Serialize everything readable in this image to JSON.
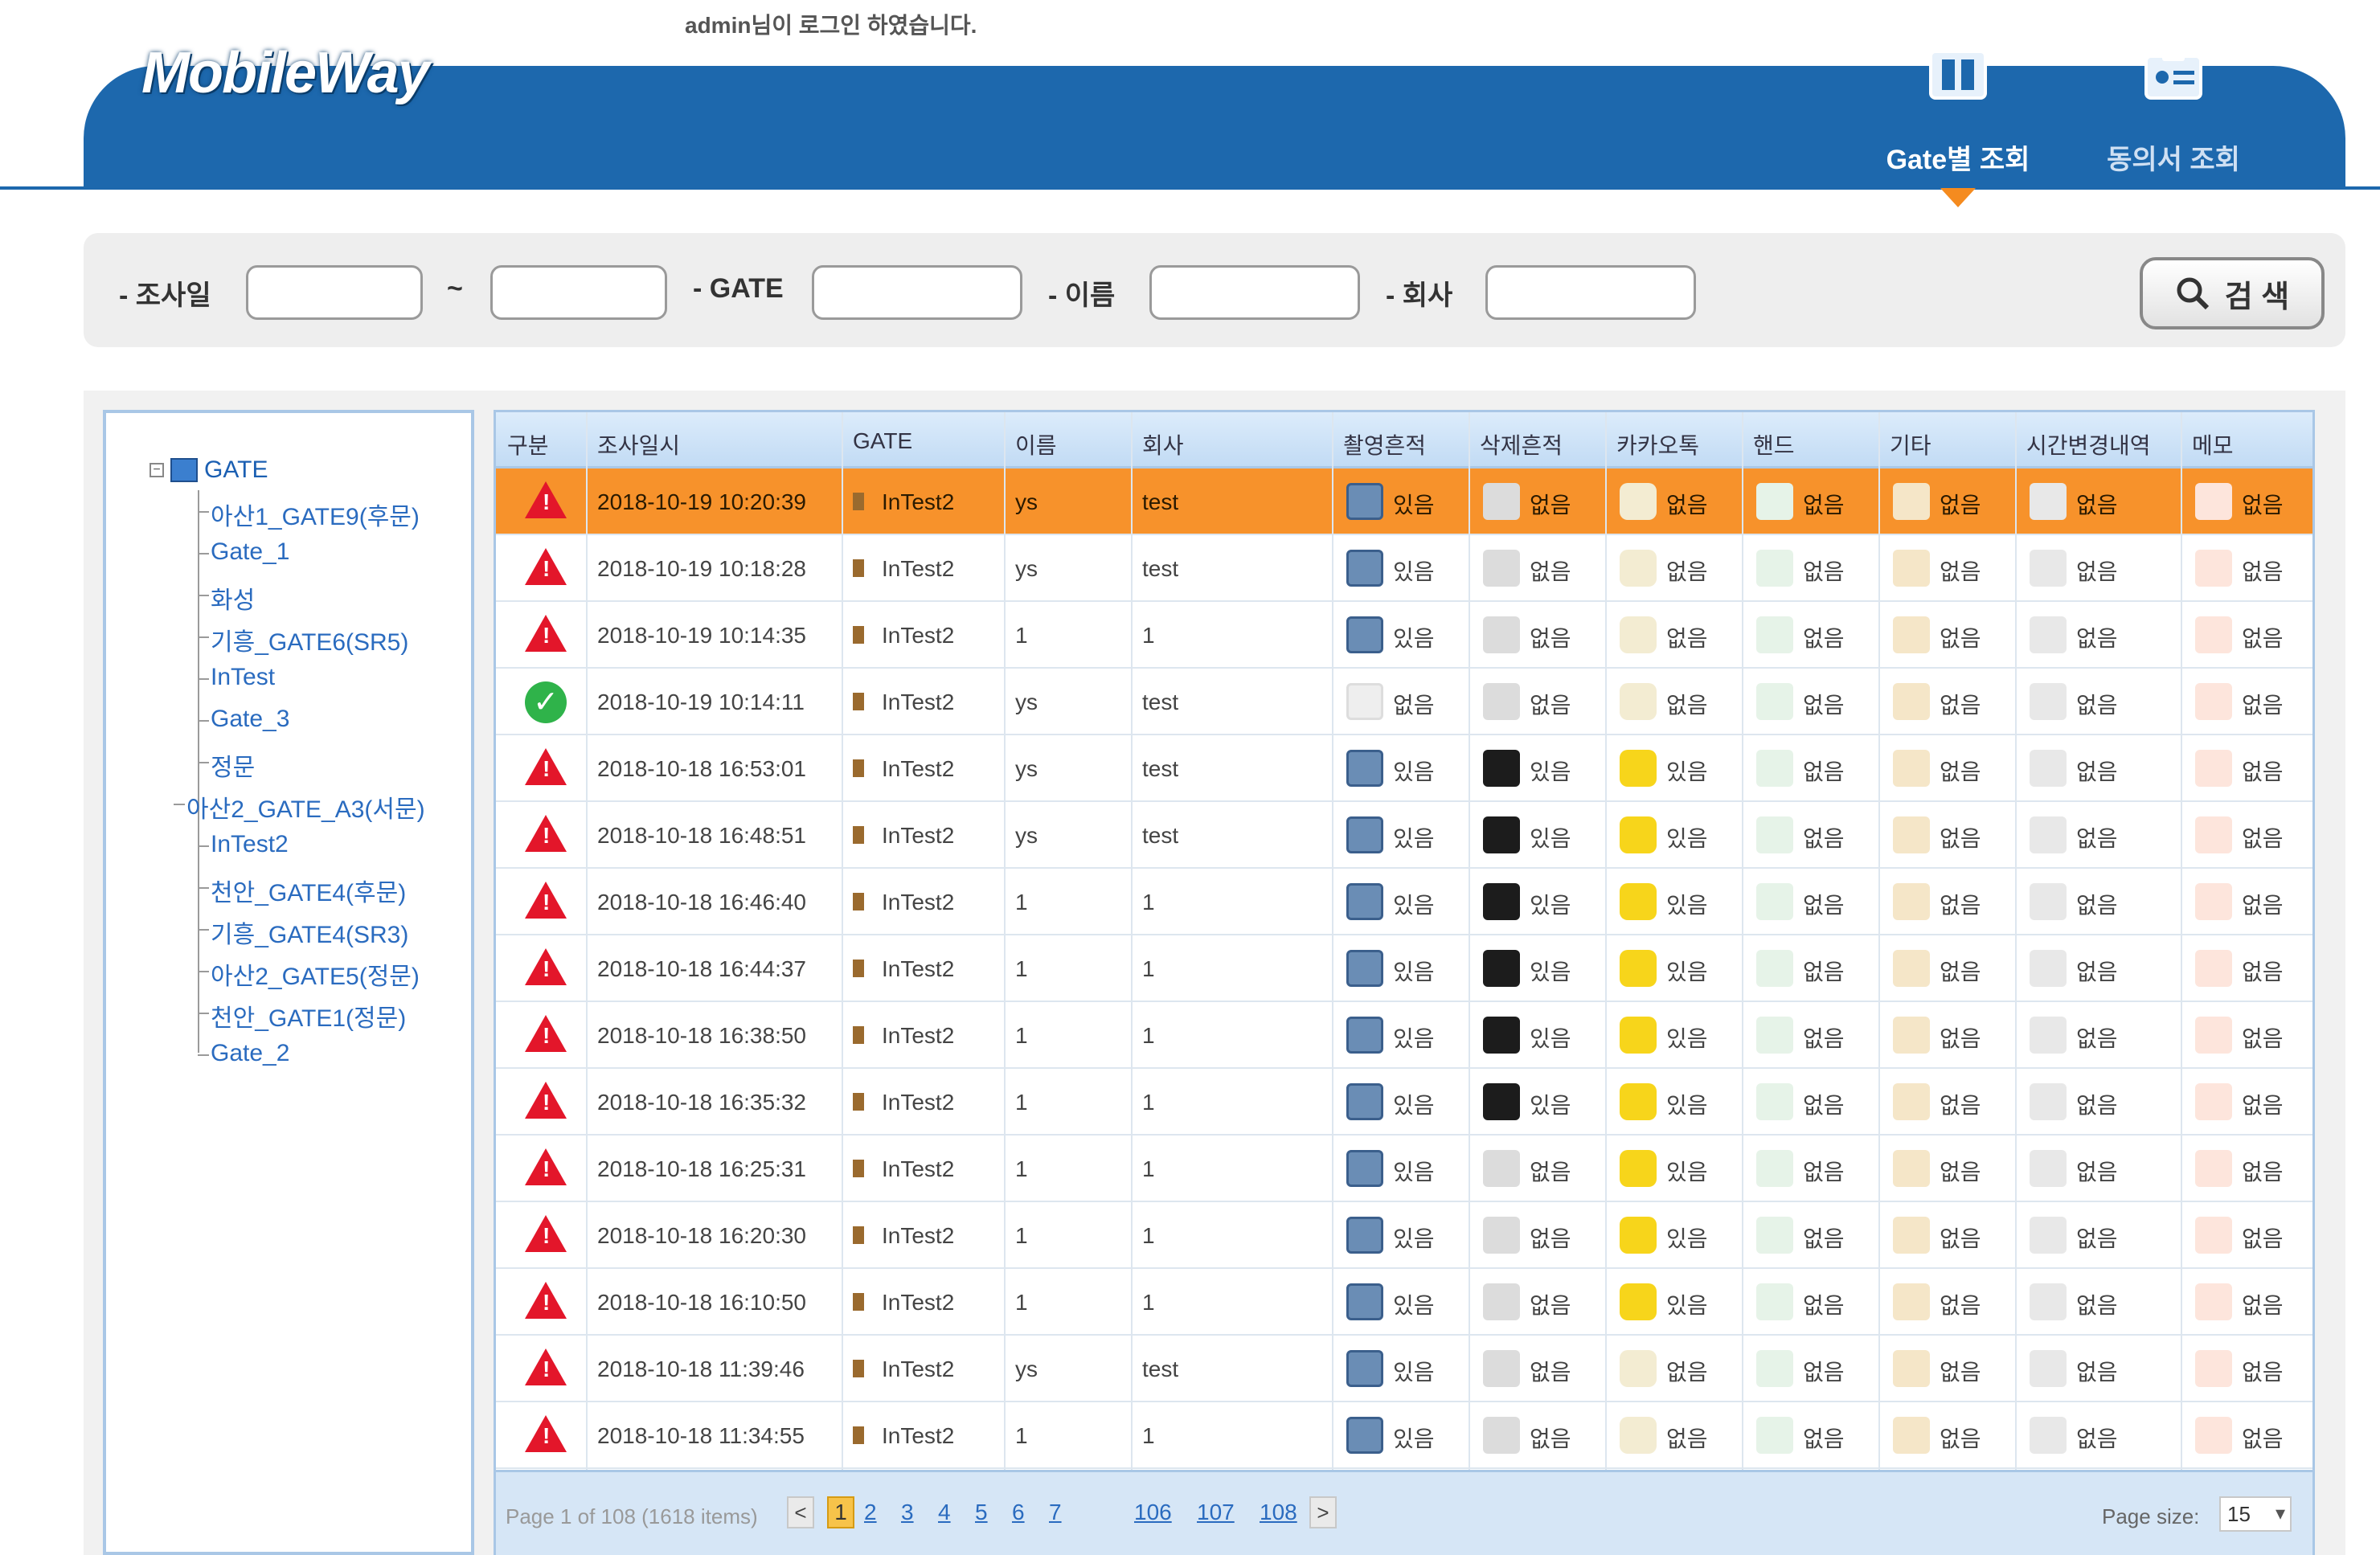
{
  "header": {
    "login_message": "admin님이 로그인 하였습니다.",
    "logo": "MobileWay",
    "tabs": [
      {
        "label": "Gate별 조회",
        "icon": "gate-icon",
        "active": true
      },
      {
        "label": "동의서 조회",
        "icon": "consent-form-icon",
        "active": false
      }
    ],
    "accent_color": "#1d68ad",
    "active_marker_color": "#f58b1f"
  },
  "search": {
    "date_label": "- 조사일",
    "range_sep": "~",
    "gate_label": "- GATE",
    "name_label": "- 이름",
    "company_label": "- 회사",
    "date_from": "",
    "date_to": "",
    "gate": "",
    "name": "",
    "company": "",
    "button_label": "검 색"
  },
  "tree": {
    "root": "GATE",
    "items": [
      "아산1_GATE9(후문)",
      "Gate_1",
      "화성",
      "기흥_GATE6(SR5)",
      "InTest",
      "Gate_3",
      "정문",
      "아산2_GATE_A3(서문)",
      "InTest2",
      "천안_GATE4(후문)",
      "기흥_GATE4(SR3)",
      "아산2_GATE5(정문)",
      "천안_GATE1(정문)",
      "Gate_2"
    ]
  },
  "grid": {
    "columns": [
      "구분",
      "조사일시",
      "GATE",
      "이름",
      "회사",
      "촬영흔적",
      "삭제흔적",
      "카카오톡",
      "핸드",
      "기타",
      "시간변경내역",
      "메모"
    ],
    "status_colors": {
      "warn": "#e3162a",
      "ok": "#2fb34a",
      "selected": "#f7922b"
    },
    "rows": [
      {
        "status": "warn",
        "datetime": "2018-10-19 10:20:39",
        "gate": "InTest2",
        "name": "ys",
        "company": "test",
        "photo": "있음",
        "delete": "없음",
        "kakao": "없음",
        "hand": "없음",
        "etc": "없음",
        "time": "없음",
        "memo": "없음",
        "selected": true
      },
      {
        "status": "warn",
        "datetime": "2018-10-19 10:18:28",
        "gate": "InTest2",
        "name": "ys",
        "company": "test",
        "photo": "있음",
        "delete": "없음",
        "kakao": "없음",
        "hand": "없음",
        "etc": "없음",
        "time": "없음",
        "memo": "없음"
      },
      {
        "status": "warn",
        "datetime": "2018-10-19 10:14:35",
        "gate": "InTest2",
        "name": "1",
        "company": "1",
        "photo": "있음",
        "delete": "없음",
        "kakao": "없음",
        "hand": "없음",
        "etc": "없음",
        "time": "없음",
        "memo": "없음"
      },
      {
        "status": "ok",
        "datetime": "2018-10-19 10:14:11",
        "gate": "InTest2",
        "name": "ys",
        "company": "test",
        "photo": "없음",
        "delete": "없음",
        "kakao": "없음",
        "hand": "없음",
        "etc": "없음",
        "time": "없음",
        "memo": "없음"
      },
      {
        "status": "warn",
        "datetime": "2018-10-18 16:53:01",
        "gate": "InTest2",
        "name": "ys",
        "company": "test",
        "photo": "있음",
        "delete": "있음",
        "kakao": "있음",
        "hand": "없음",
        "etc": "없음",
        "time": "없음",
        "memo": "없음"
      },
      {
        "status": "warn",
        "datetime": "2018-10-18 16:48:51",
        "gate": "InTest2",
        "name": "ys",
        "company": "test",
        "photo": "있음",
        "delete": "있음",
        "kakao": "있음",
        "hand": "없음",
        "etc": "없음",
        "time": "없음",
        "memo": "없음"
      },
      {
        "status": "warn",
        "datetime": "2018-10-18 16:46:40",
        "gate": "InTest2",
        "name": "1",
        "company": "1",
        "photo": "있음",
        "delete": "있음",
        "kakao": "있음",
        "hand": "없음",
        "etc": "없음",
        "time": "없음",
        "memo": "없음"
      },
      {
        "status": "warn",
        "datetime": "2018-10-18 16:44:37",
        "gate": "InTest2",
        "name": "1",
        "company": "1",
        "photo": "있음",
        "delete": "있음",
        "kakao": "있음",
        "hand": "없음",
        "etc": "없음",
        "time": "없음",
        "memo": "없음"
      },
      {
        "status": "warn",
        "datetime": "2018-10-18 16:38:50",
        "gate": "InTest2",
        "name": "1",
        "company": "1",
        "photo": "있음",
        "delete": "있음",
        "kakao": "있음",
        "hand": "없음",
        "etc": "없음",
        "time": "없음",
        "memo": "없음"
      },
      {
        "status": "warn",
        "datetime": "2018-10-18 16:35:32",
        "gate": "InTest2",
        "name": "1",
        "company": "1",
        "photo": "있음",
        "delete": "있음",
        "kakao": "있음",
        "hand": "없음",
        "etc": "없음",
        "time": "없음",
        "memo": "없음"
      },
      {
        "status": "warn",
        "datetime": "2018-10-18 16:25:31",
        "gate": "InTest2",
        "name": "1",
        "company": "1",
        "photo": "있음",
        "delete": "없음",
        "kakao": "있음",
        "hand": "없음",
        "etc": "없음",
        "time": "없음",
        "memo": "없음"
      },
      {
        "status": "warn",
        "datetime": "2018-10-18 16:20:30",
        "gate": "InTest2",
        "name": "1",
        "company": "1",
        "photo": "있음",
        "delete": "없음",
        "kakao": "있음",
        "hand": "없음",
        "etc": "없음",
        "time": "없음",
        "memo": "없음"
      },
      {
        "status": "warn",
        "datetime": "2018-10-18 16:10:50",
        "gate": "InTest2",
        "name": "1",
        "company": "1",
        "photo": "있음",
        "delete": "없음",
        "kakao": "있음",
        "hand": "없음",
        "etc": "없음",
        "time": "없음",
        "memo": "없음"
      },
      {
        "status": "warn",
        "datetime": "2018-10-18 11:39:46",
        "gate": "InTest2",
        "name": "ys",
        "company": "test",
        "photo": "있음",
        "delete": "없음",
        "kakao": "없음",
        "hand": "없음",
        "etc": "없음",
        "time": "없음",
        "memo": "없음"
      },
      {
        "status": "warn",
        "datetime": "2018-10-18 11:34:55",
        "gate": "InTest2",
        "name": "1",
        "company": "1",
        "photo": "있음",
        "delete": "없음",
        "kakao": "없음",
        "hand": "없음",
        "etc": "없음",
        "time": "없음",
        "memo": "없음"
      }
    ]
  },
  "pager": {
    "info": "Page 1 of 108 (1618 items)",
    "prev": "<",
    "next": ">",
    "pages": [
      "1",
      "2",
      "3",
      "4",
      "5",
      "6",
      "7",
      "106",
      "107",
      "108"
    ],
    "current_page": "1",
    "page_size_label": "Page size:",
    "page_size": "15"
  }
}
